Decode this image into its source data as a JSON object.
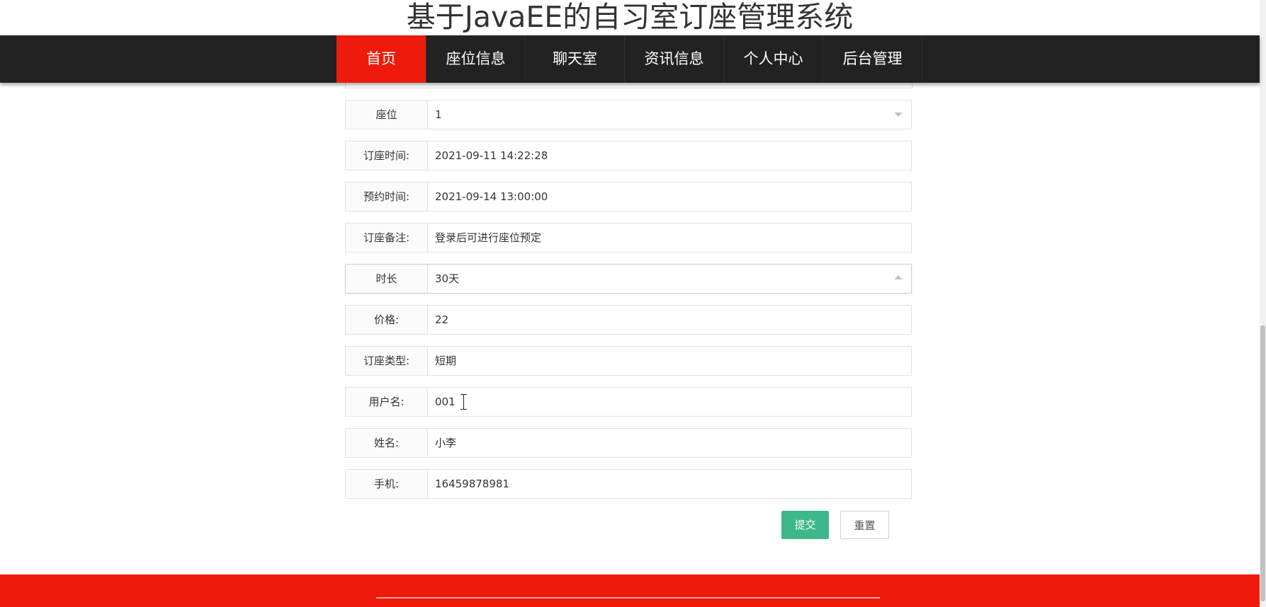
{
  "site_title": "基于JavaEE的自习室订座管理系统",
  "nav": {
    "items": [
      {
        "label": "首页",
        "active": true
      },
      {
        "label": "座位信息",
        "active": false
      },
      {
        "label": "聊天室",
        "active": false
      },
      {
        "label": "资讯信息",
        "active": false
      },
      {
        "label": "个人中心",
        "active": false
      },
      {
        "label": "后台管理",
        "active": false
      }
    ]
  },
  "form": {
    "fields": [
      {
        "label": "座位",
        "value": "1",
        "type": "select"
      },
      {
        "label": "订座时间:",
        "value": "2021-09-11 14:22:28",
        "type": "text"
      },
      {
        "label": "预约时间:",
        "value": "2021-09-14 13:00:00",
        "type": "text"
      },
      {
        "label": "订座备注:",
        "value": "登录后可进行座位预定",
        "type": "text"
      },
      {
        "label": "时长",
        "value": "30天",
        "type": "select-open"
      },
      {
        "label": "价格:",
        "value": "22",
        "type": "text"
      },
      {
        "label": "订座类型:",
        "value": "短期",
        "type": "text"
      },
      {
        "label": "用户名:",
        "value": "001",
        "type": "text"
      },
      {
        "label": "姓名:",
        "value": "小李",
        "type": "text"
      },
      {
        "label": "手机:",
        "value": "16459878981",
        "type": "text"
      }
    ],
    "submit_label": "提交",
    "reset_label": "重置"
  },
  "colors": {
    "accent_red": "#ee1b0c",
    "nav_bg": "#222222",
    "submit_green": "#3cb88b"
  },
  "icons": {
    "select_caret_down": "chevron-down-icon",
    "select_caret_up": "chevron-up-icon",
    "text_cursor": "text-cursor-icon"
  }
}
